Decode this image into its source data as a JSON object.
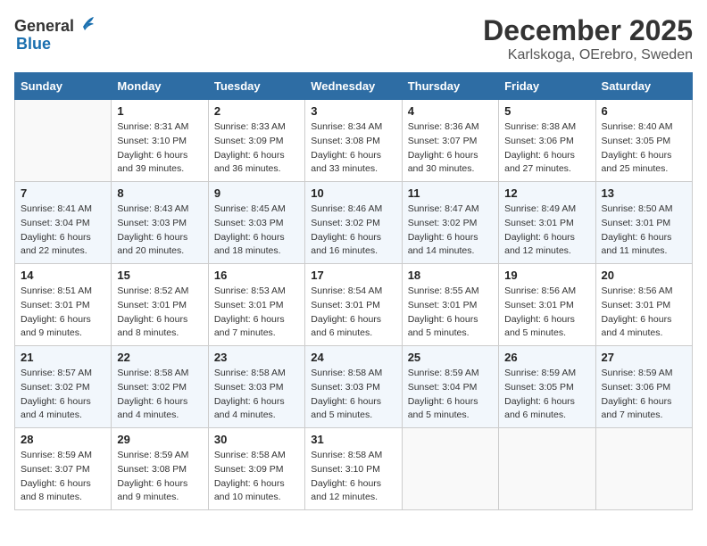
{
  "logo": {
    "general": "General",
    "blue": "Blue"
  },
  "title": "December 2025",
  "location": "Karlskoga, OErebro, Sweden",
  "weekdays": [
    "Sunday",
    "Monday",
    "Tuesday",
    "Wednesday",
    "Thursday",
    "Friday",
    "Saturday"
  ],
  "weeks": [
    [
      {
        "day": "",
        "sunrise": "",
        "sunset": "",
        "daylight": ""
      },
      {
        "day": "1",
        "sunrise": "Sunrise: 8:31 AM",
        "sunset": "Sunset: 3:10 PM",
        "daylight": "Daylight: 6 hours and 39 minutes."
      },
      {
        "day": "2",
        "sunrise": "Sunrise: 8:33 AM",
        "sunset": "Sunset: 3:09 PM",
        "daylight": "Daylight: 6 hours and 36 minutes."
      },
      {
        "day": "3",
        "sunrise": "Sunrise: 8:34 AM",
        "sunset": "Sunset: 3:08 PM",
        "daylight": "Daylight: 6 hours and 33 minutes."
      },
      {
        "day": "4",
        "sunrise": "Sunrise: 8:36 AM",
        "sunset": "Sunset: 3:07 PM",
        "daylight": "Daylight: 6 hours and 30 minutes."
      },
      {
        "day": "5",
        "sunrise": "Sunrise: 8:38 AM",
        "sunset": "Sunset: 3:06 PM",
        "daylight": "Daylight: 6 hours and 27 minutes."
      },
      {
        "day": "6",
        "sunrise": "Sunrise: 8:40 AM",
        "sunset": "Sunset: 3:05 PM",
        "daylight": "Daylight: 6 hours and 25 minutes."
      }
    ],
    [
      {
        "day": "7",
        "sunrise": "Sunrise: 8:41 AM",
        "sunset": "Sunset: 3:04 PM",
        "daylight": "Daylight: 6 hours and 22 minutes."
      },
      {
        "day": "8",
        "sunrise": "Sunrise: 8:43 AM",
        "sunset": "Sunset: 3:03 PM",
        "daylight": "Daylight: 6 hours and 20 minutes."
      },
      {
        "day": "9",
        "sunrise": "Sunrise: 8:45 AM",
        "sunset": "Sunset: 3:03 PM",
        "daylight": "Daylight: 6 hours and 18 minutes."
      },
      {
        "day": "10",
        "sunrise": "Sunrise: 8:46 AM",
        "sunset": "Sunset: 3:02 PM",
        "daylight": "Daylight: 6 hours and 16 minutes."
      },
      {
        "day": "11",
        "sunrise": "Sunrise: 8:47 AM",
        "sunset": "Sunset: 3:02 PM",
        "daylight": "Daylight: 6 hours and 14 minutes."
      },
      {
        "day": "12",
        "sunrise": "Sunrise: 8:49 AM",
        "sunset": "Sunset: 3:01 PM",
        "daylight": "Daylight: 6 hours and 12 minutes."
      },
      {
        "day": "13",
        "sunrise": "Sunrise: 8:50 AM",
        "sunset": "Sunset: 3:01 PM",
        "daylight": "Daylight: 6 hours and 11 minutes."
      }
    ],
    [
      {
        "day": "14",
        "sunrise": "Sunrise: 8:51 AM",
        "sunset": "Sunset: 3:01 PM",
        "daylight": "Daylight: 6 hours and 9 minutes."
      },
      {
        "day": "15",
        "sunrise": "Sunrise: 8:52 AM",
        "sunset": "Sunset: 3:01 PM",
        "daylight": "Daylight: 6 hours and 8 minutes."
      },
      {
        "day": "16",
        "sunrise": "Sunrise: 8:53 AM",
        "sunset": "Sunset: 3:01 PM",
        "daylight": "Daylight: 6 hours and 7 minutes."
      },
      {
        "day": "17",
        "sunrise": "Sunrise: 8:54 AM",
        "sunset": "Sunset: 3:01 PM",
        "daylight": "Daylight: 6 hours and 6 minutes."
      },
      {
        "day": "18",
        "sunrise": "Sunrise: 8:55 AM",
        "sunset": "Sunset: 3:01 PM",
        "daylight": "Daylight: 6 hours and 5 minutes."
      },
      {
        "day": "19",
        "sunrise": "Sunrise: 8:56 AM",
        "sunset": "Sunset: 3:01 PM",
        "daylight": "Daylight: 6 hours and 5 minutes."
      },
      {
        "day": "20",
        "sunrise": "Sunrise: 8:56 AM",
        "sunset": "Sunset: 3:01 PM",
        "daylight": "Daylight: 6 hours and 4 minutes."
      }
    ],
    [
      {
        "day": "21",
        "sunrise": "Sunrise: 8:57 AM",
        "sunset": "Sunset: 3:02 PM",
        "daylight": "Daylight: 6 hours and 4 minutes."
      },
      {
        "day": "22",
        "sunrise": "Sunrise: 8:58 AM",
        "sunset": "Sunset: 3:02 PM",
        "daylight": "Daylight: 6 hours and 4 minutes."
      },
      {
        "day": "23",
        "sunrise": "Sunrise: 8:58 AM",
        "sunset": "Sunset: 3:03 PM",
        "daylight": "Daylight: 6 hours and 4 minutes."
      },
      {
        "day": "24",
        "sunrise": "Sunrise: 8:58 AM",
        "sunset": "Sunset: 3:03 PM",
        "daylight": "Daylight: 6 hours and 5 minutes."
      },
      {
        "day": "25",
        "sunrise": "Sunrise: 8:59 AM",
        "sunset": "Sunset: 3:04 PM",
        "daylight": "Daylight: 6 hours and 5 minutes."
      },
      {
        "day": "26",
        "sunrise": "Sunrise: 8:59 AM",
        "sunset": "Sunset: 3:05 PM",
        "daylight": "Daylight: 6 hours and 6 minutes."
      },
      {
        "day": "27",
        "sunrise": "Sunrise: 8:59 AM",
        "sunset": "Sunset: 3:06 PM",
        "daylight": "Daylight: 6 hours and 7 minutes."
      }
    ],
    [
      {
        "day": "28",
        "sunrise": "Sunrise: 8:59 AM",
        "sunset": "Sunset: 3:07 PM",
        "daylight": "Daylight: 6 hours and 8 minutes."
      },
      {
        "day": "29",
        "sunrise": "Sunrise: 8:59 AM",
        "sunset": "Sunset: 3:08 PM",
        "daylight": "Daylight: 6 hours and 9 minutes."
      },
      {
        "day": "30",
        "sunrise": "Sunrise: 8:58 AM",
        "sunset": "Sunset: 3:09 PM",
        "daylight": "Daylight: 6 hours and 10 minutes."
      },
      {
        "day": "31",
        "sunrise": "Sunrise: 8:58 AM",
        "sunset": "Sunset: 3:10 PM",
        "daylight": "Daylight: 6 hours and 12 minutes."
      },
      {
        "day": "",
        "sunrise": "",
        "sunset": "",
        "daylight": ""
      },
      {
        "day": "",
        "sunrise": "",
        "sunset": "",
        "daylight": ""
      },
      {
        "day": "",
        "sunrise": "",
        "sunset": "",
        "daylight": ""
      }
    ]
  ]
}
